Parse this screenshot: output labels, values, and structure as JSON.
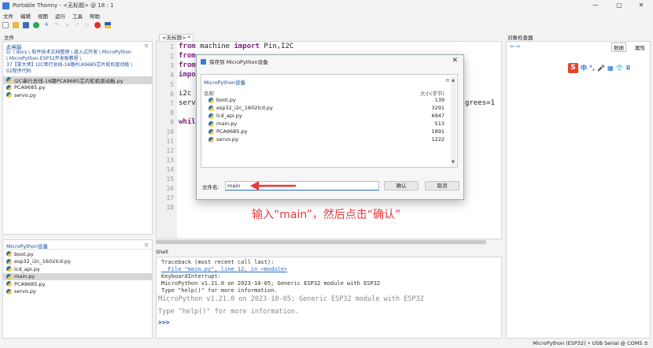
{
  "window": {
    "title": "Portable Thonny  -  <无标题>  @  18 : 1",
    "controls": [
      "—",
      "▢",
      "✕"
    ]
  },
  "menu": [
    "文件",
    "编辑",
    "视图",
    "运行",
    "工具",
    "帮助"
  ],
  "files_pane": {
    "tab": "文件",
    "header": "此电脑",
    "path_lines": [
      "D: \\ docs \\ 软件技术文档整理 \\ 嵌入式开发 \\ MicroPython",
      "\\ MicroPython ESP32开发板教程 \\",
      "37【拿大师】I2C串行总线-16路PCA9685芯片舵机驱动板 \\",
      "02程序代码"
    ],
    "files": [
      {
        "name": "I2C串行总线-16路PCA9685芯片舵机驱动板.py",
        "selected": true
      },
      {
        "name": "PCA9685.py",
        "selected": false
      },
      {
        "name": "servo.py",
        "selected": false
      }
    ]
  },
  "device_pane": {
    "header": "MicroPython设备",
    "files": [
      {
        "name": "boot.py",
        "selected": false
      },
      {
        "name": "esp32_i2c_1602lcd.py",
        "selected": false
      },
      {
        "name": "lcd_api.py",
        "selected": false
      },
      {
        "name": "main.py",
        "selected": true
      },
      {
        "name": "PCA9685.py",
        "selected": false
      },
      {
        "name": "servo.py",
        "selected": false
      }
    ]
  },
  "editor": {
    "tab": "<无标题> *",
    "line_numbers": [
      "1",
      "2",
      "3",
      "4",
      "5",
      "6",
      "7",
      "8",
      "9",
      "10",
      "11",
      "12",
      "13",
      "14",
      "15",
      "16",
      "17",
      "18"
    ],
    "code": {
      "l1_kw": "from",
      "l1_rest": " machine ",
      "l1_kw2": "import",
      "l1_rest2": " Pin,I2C",
      "l2_kw": "from",
      "l3_kw": "from",
      "l4_kw": "impo",
      "l6": "i2c",
      "l7_left": "serv",
      "l7_right": "grees=1",
      "l9_kw": "whil"
    }
  },
  "shell": {
    "tab": "Shell",
    "lines": [
      "Traceback (most recent call last):",
      "  File \"main.py\", line 12, in <module>",
      "KeyboardInterrupt:",
      "MicroPython v1.21.0 on 2023-10-05; Generic ESP32 module with ESP32",
      "Type \"help()\" for more information."
    ],
    "big_lines": [
      "MicroPython v1.21.0 on 2023-10-05; Generic ESP32 module with ESP32",
      "Type \"help()\" for more information."
    ],
    "prompt": ">>>"
  },
  "right_pane": {
    "tab": "对象检查器",
    "nav": "⇦ ⇨",
    "tabs": [
      "数据",
      "属性"
    ],
    "ime": {
      "logo": "S",
      "items": [
        "中",
        "°,",
        "🎤",
        "▦",
        "👕",
        "⠿"
      ]
    }
  },
  "dialog": {
    "title": "保存到 MicroPython设备",
    "location": "MicroPython设备",
    "col_name": "名称",
    "col_size": "大小(字节)",
    "files": [
      {
        "name": "boot.py",
        "size": "139"
      },
      {
        "name": "esp32_i2c_1602lcd.py",
        "size": "3291"
      },
      {
        "name": "lcd_api.py",
        "size": "6947"
      },
      {
        "name": "main.py",
        "size": "513"
      },
      {
        "name": "PCA9685.py",
        "size": "1891"
      },
      {
        "name": "servo.py",
        "size": "1222"
      }
    ],
    "filename_label": "文件名:",
    "filename_value": "main",
    "ok_label": "确认",
    "cancel_label": "取消"
  },
  "annotation": "输入“main”，然后点击“确认”",
  "annotation_color": "#e8383b",
  "status": "MicroPython (ESP32)  •  USB Serial @ COM5  ≡"
}
